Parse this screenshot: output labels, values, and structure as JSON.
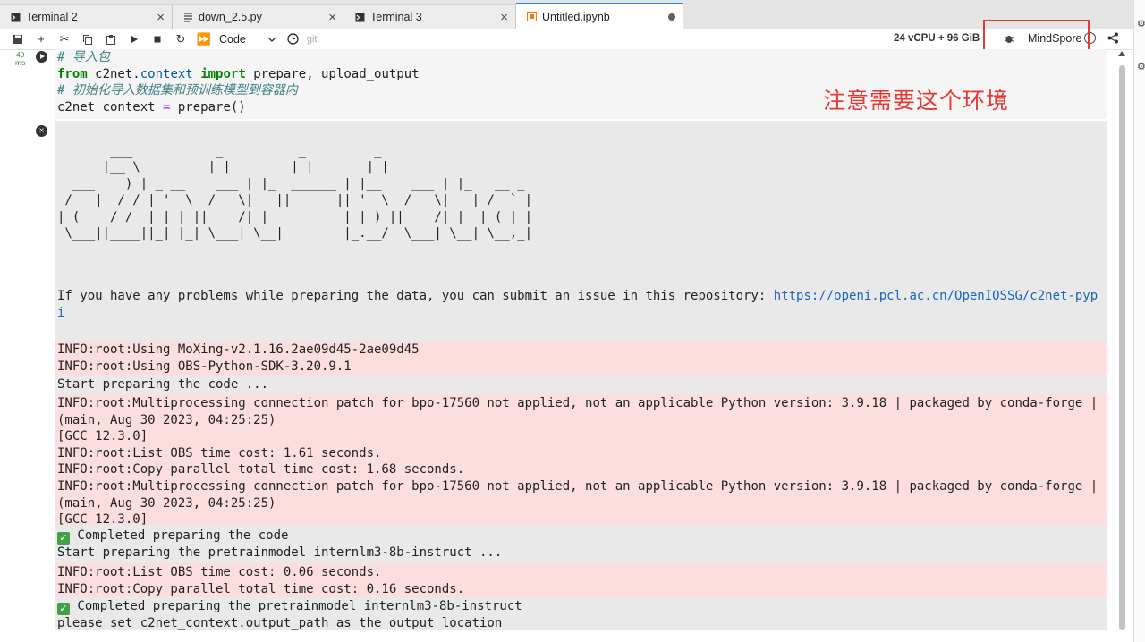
{
  "tabs": [
    {
      "label": "Terminal 2",
      "icon": "terminal-icon",
      "active": false,
      "close": "×"
    },
    {
      "label": "down_2.5.py",
      "icon": "file-icon",
      "active": false,
      "close": "×"
    },
    {
      "label": "Terminal 3",
      "icon": "terminal-icon",
      "active": false,
      "close": "×"
    },
    {
      "label": "Untitled.ipynb",
      "icon": "notebook-icon",
      "active": true
    }
  ],
  "toolbar": {
    "cell_type": "Code",
    "git_label": "git",
    "resources": "24 vCPU + 96 GiB",
    "kernel_name": "MindSpore"
  },
  "cell": {
    "exec_time_value": "40",
    "exec_time_unit": "ms",
    "code_lines": [
      {
        "parts": [
          {
            "t": "# 导入包",
            "c": "cm"
          }
        ]
      },
      {
        "parts": [
          {
            "t": "from",
            "c": "kw"
          },
          {
            "t": " c2net",
            "c": ""
          },
          {
            "t": ".",
            "c": ""
          },
          {
            "t": "context",
            "c": "mod"
          },
          {
            "t": " ",
            "c": ""
          },
          {
            "t": "import",
            "c": "kw"
          },
          {
            "t": " prepare, upload_output",
            "c": ""
          }
        ]
      },
      {
        "parts": [
          {
            "t": "# 初始化导入数据集和预训练模型到容器内",
            "c": "cm"
          }
        ]
      },
      {
        "parts": [
          {
            "t": "c2net_context ",
            "c": ""
          },
          {
            "t": "=",
            "c": "op"
          },
          {
            "t": " prepare()",
            "c": ""
          }
        ]
      }
    ]
  },
  "annotation_note": "注意需要这个环境",
  "output": {
    "ascii_art": [
      "       ___           _          _         _",
      "      |__ \\         | |        | |       | |",
      "  ___    ) | _ __    ___ | |_  ______ | |__    ___ | |_   __ _",
      " / __|  / / | '_ \\  / _ \\| __||______|| '_ \\  / _ \\| __| / _` |",
      "| (__  / /_ | | | ||  __/| |_         | |_) ||  __/| |_ | (_| |",
      " \\___||____||_| |_| \\___| \\__|        |_.__/  \\___| \\__| \\__,_|"
    ],
    "problem_text": "If you have any problems while preparing the data, you can submit an issue in this repository: ",
    "problem_link_1": "https://openi.pcl.ac.cn/OpenIOSSG/c2net-pyp",
    "problem_link_2": "i",
    "blocks": [
      {
        "style": "pink",
        "lines": [
          "INFO:root:Using MoXing-v2.1.16.2ae09d45-2ae09d45",
          "INFO:root:Using OBS-Python-SDK-3.20.9.1"
        ]
      },
      {
        "style": "plain",
        "lines": [
          "Start preparing the code ..."
        ]
      },
      {
        "style": "pink",
        "lines": [
          "INFO:root:Multiprocessing connection patch for bpo-17560 not applied, not an applicable Python version: 3.9.18 | packaged by conda-forge |",
          "(main, Aug 30 2023, 04:25:25)",
          "[GCC 12.3.0]",
          "INFO:root:List OBS time cost: 1.61 seconds.",
          "INFO:root:Copy parallel total time cost: 1.68 seconds.",
          "INFO:root:Multiprocessing connection patch for bpo-17560 not applied, not an applicable Python version: 3.9.18 | packaged by conda-forge |",
          "(main, Aug 30 2023, 04:25:25)",
          "[GCC 12.3.0]"
        ]
      },
      {
        "style": "plain",
        "lines": [
          "✅ Completed preparing the code",
          "Start preparing the pretrainmodel internlm3-8b-instruct ..."
        ]
      },
      {
        "style": "pink",
        "lines": [
          "INFO:root:List OBS time cost: 0.06 seconds.",
          "INFO:root:Copy parallel total time cost: 0.16 seconds."
        ]
      },
      {
        "style": "plain",
        "lines": [
          "✅ Completed preparing the pretrainmodel internlm3-8b-instruct",
          "please set c2net_context.output_path as the output location"
        ]
      }
    ]
  }
}
